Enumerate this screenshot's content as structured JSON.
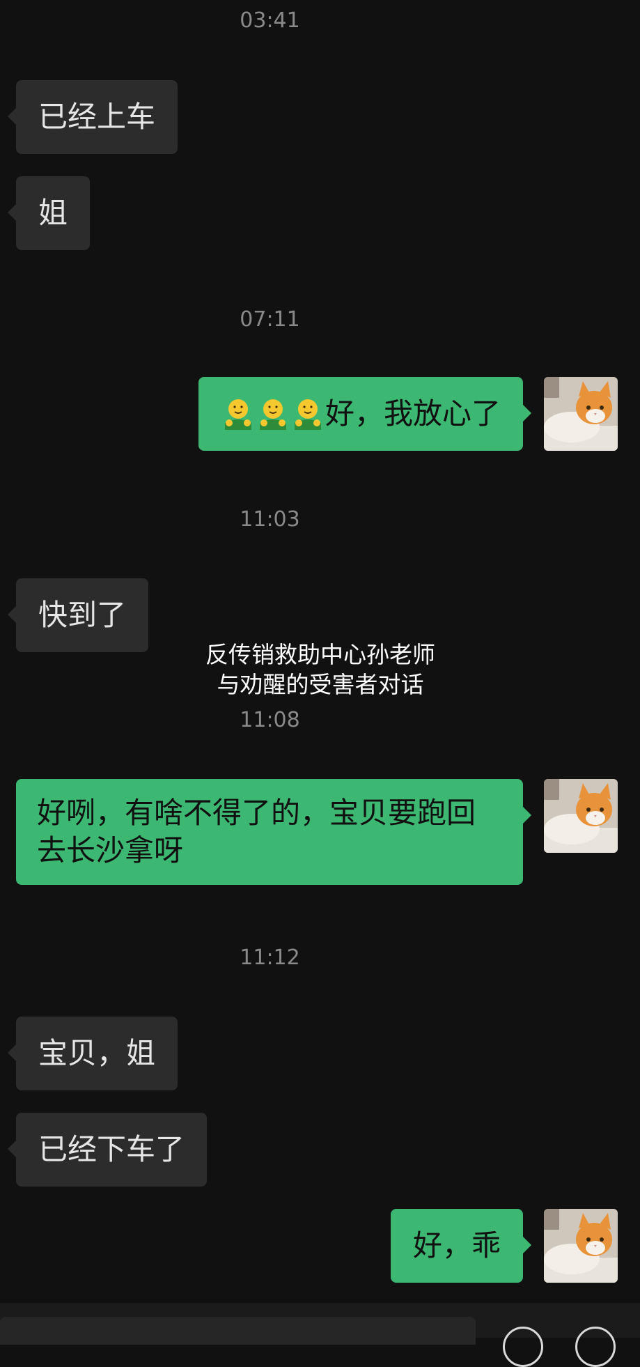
{
  "messages": [
    {
      "type": "time",
      "text": "03:41"
    },
    {
      "type": "in",
      "text": "已经上车"
    },
    {
      "type": "in",
      "text": "姐"
    },
    {
      "type": "time",
      "text": "07:11"
    },
    {
      "type": "out",
      "emoji": [
        "hugging-emoji",
        "hugging-emoji",
        "hugging-emoji"
      ],
      "text": "好，我放心了"
    },
    {
      "type": "time",
      "text": "11:03"
    },
    {
      "type": "in",
      "text": "快到了"
    },
    {
      "type": "time",
      "text": "11:08"
    },
    {
      "type": "out",
      "text": "好咧，有啥不得了的，宝贝要跑回去长沙拿呀"
    },
    {
      "type": "time",
      "text": "11:12"
    },
    {
      "type": "in",
      "text": "宝贝，姐"
    },
    {
      "type": "in",
      "text": "已经下车了"
    },
    {
      "type": "out",
      "text": "好，乖"
    }
  ],
  "watermark": {
    "line1": "反传销救助中心孙老师",
    "line2": "与劝醒的受害者对话"
  },
  "colors": {
    "background": "#111111",
    "incoming_bubble": "#2c2c2c",
    "outgoing_bubble": "#3db873",
    "timestamp": "#8a8a8a"
  },
  "avatar_icon": "orange-white-cat-avatar"
}
